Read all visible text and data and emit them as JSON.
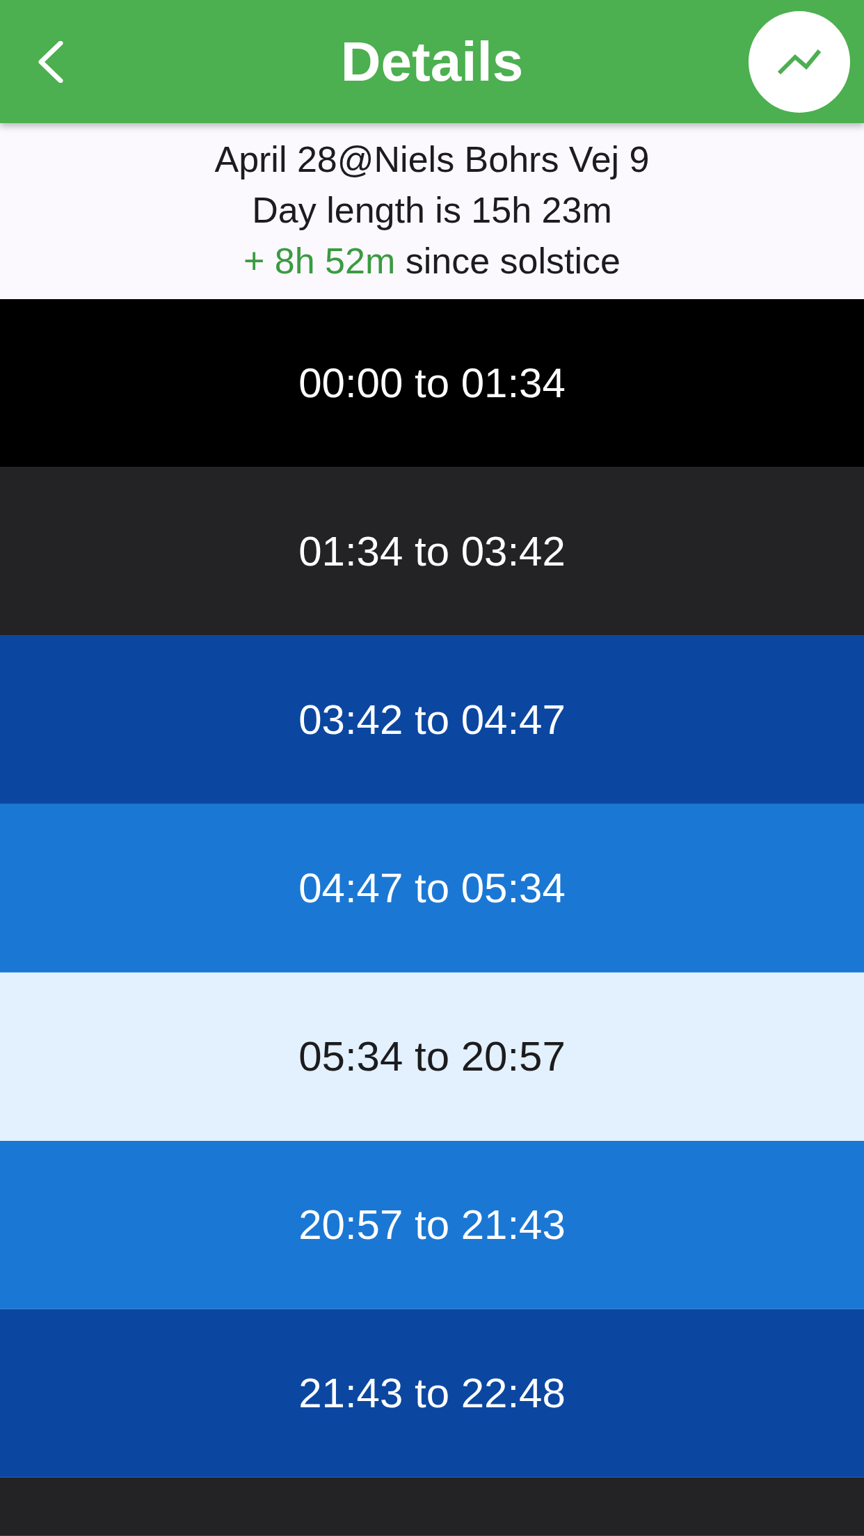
{
  "app_bar": {
    "title": "Details"
  },
  "summary": {
    "place": "April 28@Niels Bohrs Vej 9",
    "day_length": "Day length is 15h 23m",
    "solstice_change": "+ 8h 52m",
    "solstice_text": "since solstice"
  },
  "periods": [
    {
      "label": "00:00 to 01:34",
      "color": "#000000"
    },
    {
      "label": "01:34 to 03:42",
      "color": "#232225"
    },
    {
      "label": "03:42 to 04:47",
      "color": "#0b47a0"
    },
    {
      "label": "04:47 to 05:34",
      "color": "#1b77d4"
    },
    {
      "label": "05:34 to 20:57",
      "color": "#e3f0fd"
    },
    {
      "label": "20:57 to 21:43",
      "color": "#1b77d4"
    },
    {
      "label": "21:43 to 22:48",
      "color": "#0b47a0"
    },
    {
      "color": "#232225"
    }
  ]
}
